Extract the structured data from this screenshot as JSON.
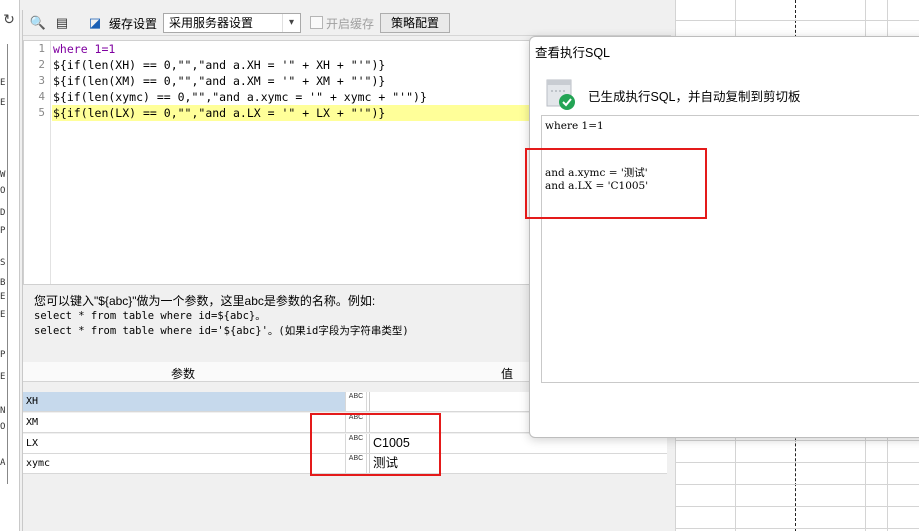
{
  "toolbar": {
    "cache_setting_label": "缓存设置",
    "cache_setting_value": "采用服务器设置",
    "enable_cache_label": "开启缓存",
    "strategy_button": "策略配置"
  },
  "editor": {
    "line_numbers": [
      "1",
      "2",
      "3",
      "4",
      "5"
    ],
    "lines": [
      {
        "kw": "where",
        "rest": " 1=1"
      },
      {
        "kw": "",
        "rest": "${if(len(XH) == 0,\"\",\"and a.XH = '\" + XH + \"'\")}"
      },
      {
        "kw": "",
        "rest": "${if(len(XM) == 0,\"\",\"and a.XM = '\" + XM + \"'\")}"
      },
      {
        "kw": "",
        "rest": "${if(len(xymc) == 0,\"\",\"and a.xymc = '\" + xymc + \"'\")}"
      },
      {
        "kw": "",
        "rest": "${if(len(LX) == 0,\"\",\"and a.LX = '\" + LX + \"'\")}"
      }
    ]
  },
  "hint": {
    "line1": "您可以键入\"${abc}\"做为一个参数，这里abc是参数的名称。例如:",
    "line2": "select * from table where id=${abc}。",
    "line3": "select * from table where id='${abc}'。(如果id字段为字符串类型)"
  },
  "params": {
    "col_param": "参数",
    "col_value": "值",
    "type_icon_text": "ABC",
    "rows": [
      {
        "name": "XH",
        "value": ""
      },
      {
        "name": "XM",
        "value": ""
      },
      {
        "name": "LX",
        "value": "C1005"
      },
      {
        "name": "xymc",
        "value": "测试"
      }
    ]
  },
  "sql_window": {
    "title": "查看执行SQL",
    "message": "已生成执行SQL，并自动复制到剪切板",
    "sql_lines": [
      "where 1=1",
      "",
      "",
      "and a.xymc = '测试'",
      "and a.LX = 'C1005'"
    ]
  },
  "left_strip": {
    "chars": [
      "E",
      "E",
      "W",
      "O",
      "D",
      "P",
      "S",
      "B",
      "E",
      "E",
      "P",
      "E",
      "N",
      "O",
      "A"
    ]
  },
  "colors": {
    "highlight_line": "#ffff99",
    "keyword": "#7f00a0",
    "annotation_red": "#e41a1a",
    "selected_row": "#c6d9ec",
    "success_green": "#23a455"
  }
}
